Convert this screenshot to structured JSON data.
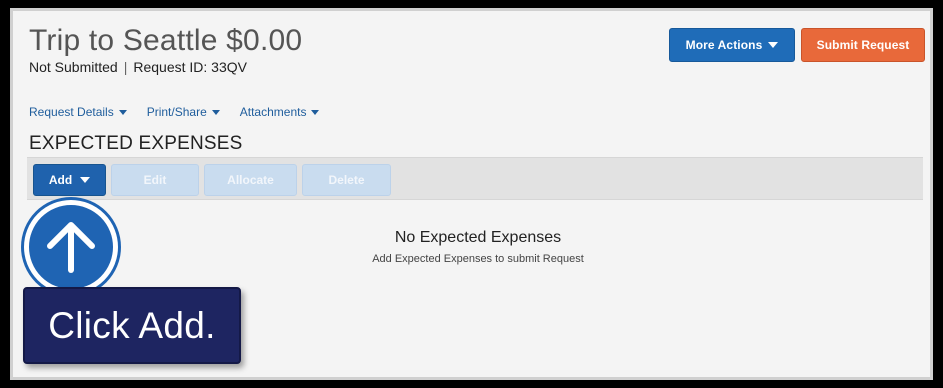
{
  "header": {
    "title": "Trip to Seattle $0.00",
    "status": "Not Submitted",
    "separator": "|",
    "request_id_label": "Request ID: 33QV"
  },
  "actions": {
    "more_actions_label": "More Actions",
    "submit_request_label": "Submit Request"
  },
  "links": {
    "request_details": "Request Details",
    "print_share": "Print/Share",
    "attachments": "Attachments"
  },
  "section": {
    "title": "EXPECTED EXPENSES"
  },
  "toolbar": {
    "add_label": "Add",
    "edit_label": "Edit",
    "allocate_label": "Allocate",
    "delete_label": "Delete"
  },
  "empty_state": {
    "title": "No Expected Expenses",
    "subtitle": "Add Expected Expenses to submit Request"
  },
  "overlay": {
    "icon": "arrow-up-icon",
    "callout_text": "Click Add."
  },
  "colors": {
    "primary_blue": "#1f6cb8",
    "submit_orange": "#e8693a",
    "link_blue": "#1f5d9c",
    "callout_navy": "#1e2561",
    "disabled_blue": "#c9dcef"
  }
}
